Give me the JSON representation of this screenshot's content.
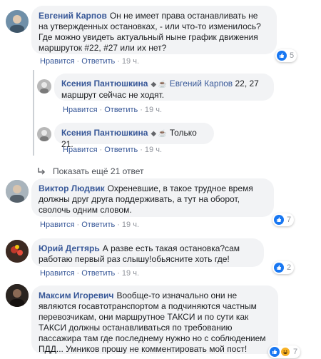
{
  "comments": [
    {
      "author": "Евгений Карпов",
      "text": "Он не имеет права останавливать не на утвержденных остановках, - или что-то изменилось? Где можно увидеть актуальный ныне график движения маршруток #22, #27 или их нет?",
      "like": "Нравится",
      "reply": "Ответить",
      "time": "19 ч.",
      "reactions": "5",
      "avatar_color": "#6f8fa8"
    },
    {
      "author": "Ксения Пантюшкина",
      "mention": "Евгений Карпов",
      "text": " 22, 27 маршрут сейчас не ходят.",
      "like": "Нравится",
      "reply": "Ответить",
      "time": "19 ч.",
      "avatar_color": "#b8b8b8"
    },
    {
      "author": "Ксения Пантюшкина",
      "text": "Только 21.",
      "like": "Нравится",
      "reply": "Ответить",
      "time": "19 ч.",
      "avatar_color": "#b8b8b8"
    },
    {
      "author": "Виктор Людвик",
      "text": "Охреневшие, в такое трудное время должны друг друга поддерживать, а тут на оборот, сволочь одним словом.",
      "like": "Нравится",
      "reply": "Ответить",
      "time": "19 ч.",
      "reactions": "7",
      "avatar_color": "#8e9aa3"
    },
    {
      "author": "Юрий Дегтярь",
      "text": "А разве есть такая остановка?сам работаю первый раз слышу!обьясните хоть где!",
      "like": "Нравится",
      "reply": "Ответить",
      "time": "19 ч.",
      "reactions": "2",
      "avatar_color": "#6b3a2e"
    },
    {
      "author": "Максим Игоревич",
      "text": "Вообще-то изначально они не являются госавтотранспортом а подчиняются частным перевозчикам, они маршрутное ТАКСИ и по сути как ТАКСИ должны останавливаться по требованию пассажира там где последнему нужно но с соблюдением ПДД... Умников прошу не комментировать мой пост!",
      "reactions": "7",
      "avatar_color": "#2b2521"
    }
  ],
  "show_more": "Показать ещё 21 ответ",
  "colors": {
    "link": "#385898",
    "bubble": "#f2f3f5",
    "like": "#1877f2"
  }
}
